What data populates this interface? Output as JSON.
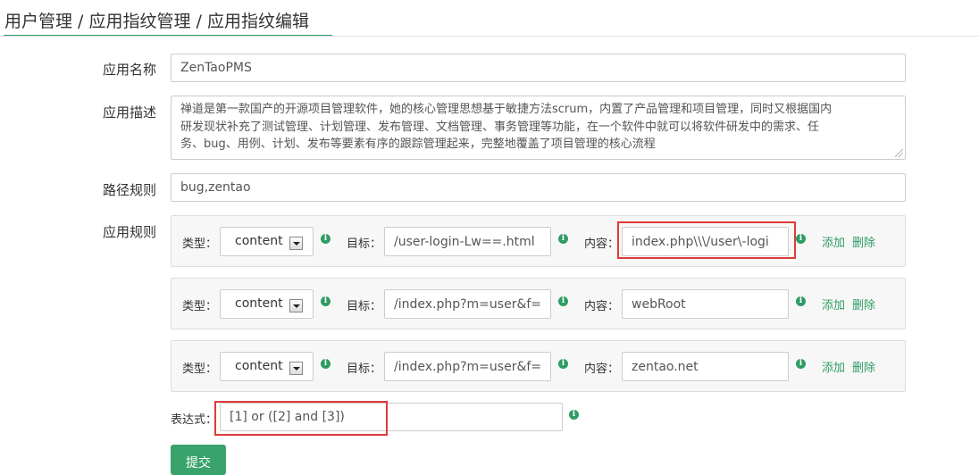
{
  "breadcrumb": {
    "text": "用户管理 / 应用指纹管理 / 应用指纹编辑"
  },
  "form": {
    "app_name_label": "应用名称",
    "app_name_value": "ZenTaoPMS",
    "app_desc_label": "应用描述",
    "app_desc_lines": [
      "禅道是第一款国产的开源项目管理软件，她的核心管理思想基于敏捷方法scrum，内置了产品管理和项目管理，同时又根据国内",
      "研发现状补充了测试管理、计划管理、发布管理、文档管理、事务管理等功能，在一个软件中就可以将软件研发中的需求、任",
      "务、bug、用例、计划、发布等要素有序的跟踪管理起来，完整地覆盖了项目管理的核心流程"
    ],
    "path_rule_label": "路径规则",
    "path_rule_value": "bug,zentao",
    "app_rule_label": "应用规则",
    "rules": [
      {
        "type_label": "类型：",
        "type_value": "content",
        "target_label": "目标：",
        "target_value": "/user-login-Lw==.html",
        "content_label": "内容：",
        "content_value": "index.php\\\\\\/user\\-logi",
        "add_label": "添加",
        "delete_label": "删除"
      },
      {
        "type_label": "类型：",
        "type_value": "content",
        "target_label": "目标：",
        "target_value": "/index.php?m=user&f=",
        "content_label": "内容：",
        "content_value": "webRoot",
        "add_label": "添加",
        "delete_label": "删除"
      },
      {
        "type_label": "类型：",
        "type_value": "content",
        "target_label": "目标：",
        "target_value": "/index.php?m=user&f=",
        "content_label": "内容：",
        "content_value": "zentao.net",
        "add_label": "添加",
        "delete_label": "删除"
      }
    ],
    "expression_label": "表达式：",
    "expression_value": "[1] or ([2] and [3])",
    "submit_label": "提交"
  },
  "colors": {
    "accent": "#2e9c63",
    "highlight": "#e03a3a"
  },
  "icons": {
    "info": "info-circle-icon",
    "select_arrow": "chevron-down-icon"
  }
}
